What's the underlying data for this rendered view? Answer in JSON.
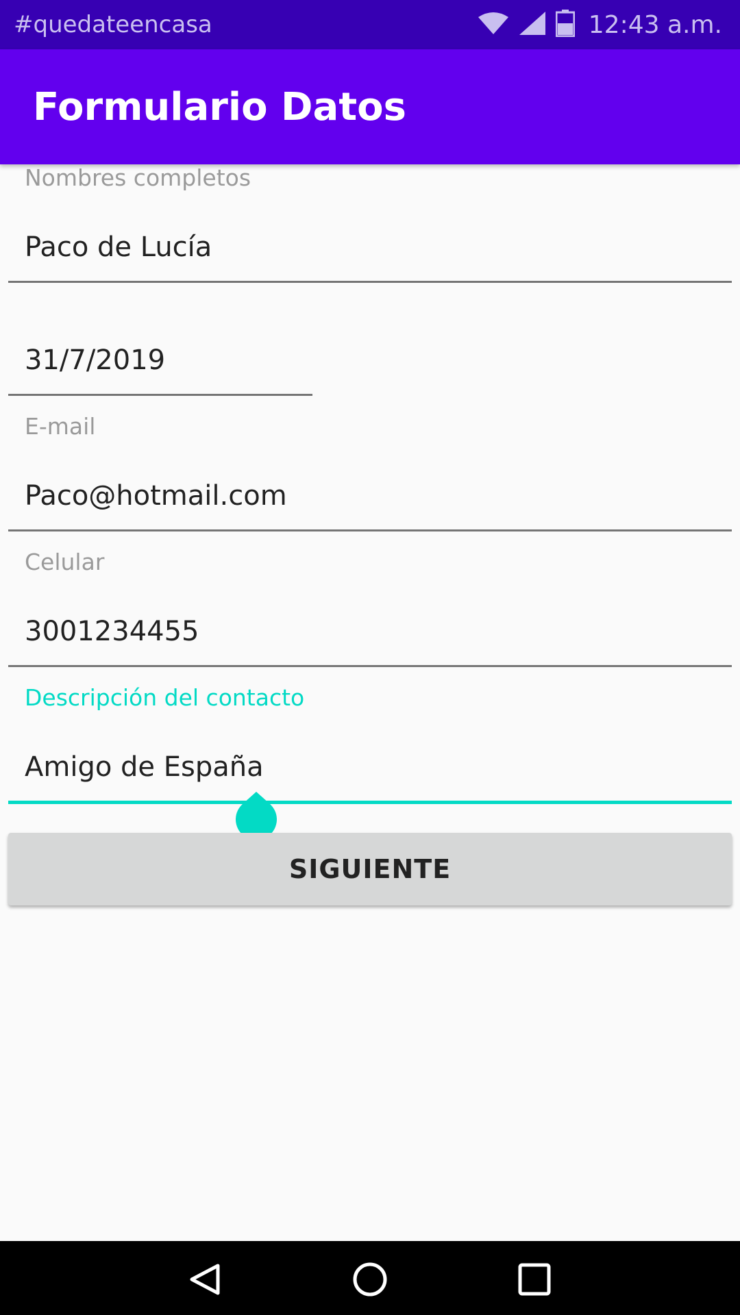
{
  "status_bar": {
    "left_text": "#quedateencasa",
    "time": "12:43 a.m.",
    "icons": [
      "wifi-icon",
      "cell-signal-icon",
      "battery-icon"
    ]
  },
  "app_bar": {
    "title": "Formulario Datos"
  },
  "form": {
    "name": {
      "label": "Nombres completos",
      "value": "Paco de Lucía"
    },
    "date": {
      "value": "31/7/2019"
    },
    "email": {
      "label": "E-mail",
      "value": "Paco@hotmail.com"
    },
    "phone": {
      "label": "Celular",
      "value": "3001234455"
    },
    "description": {
      "label": "Descripción del contacto",
      "value": "Amigo de España"
    }
  },
  "next_button": {
    "label": "SIGUIENTE"
  },
  "nav_bar": {
    "icons": [
      "back-icon",
      "home-icon",
      "recents-icon"
    ]
  },
  "colors": {
    "status_bar": "#3700b3",
    "app_bar": "#6200ee",
    "accent": "#03dac5",
    "button": "#d6d7d7",
    "background": "#fafafa"
  }
}
